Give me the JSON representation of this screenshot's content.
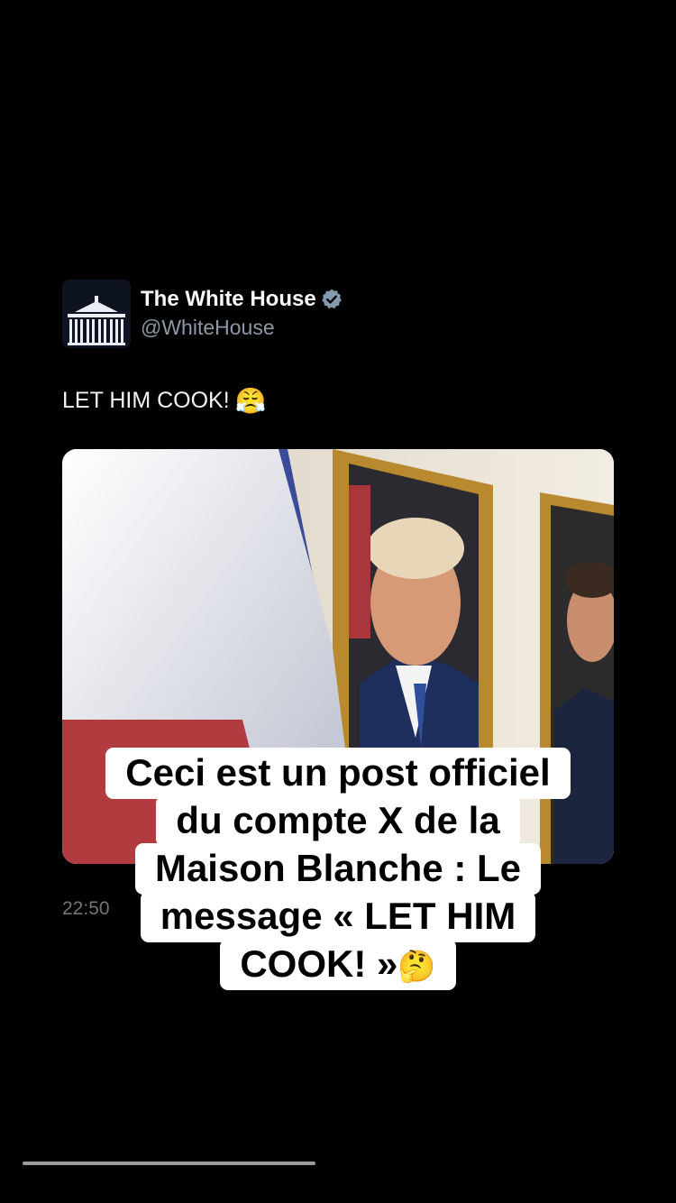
{
  "post": {
    "author_name": "The White House",
    "author_handle": "@WhiteHouse",
    "verified_icon": "verified-badge-icon",
    "text": "LET HIM COOK!",
    "text_emoji": "😤",
    "timestamp": "22:50"
  },
  "caption": {
    "lines": [
      "Ceci est un post officiel",
      "du compte X de la",
      "Maison Blanche : Le",
      "message « LET HIM",
      "COOK! »"
    ],
    "end_emoji": "🤔"
  },
  "colors": {
    "background": "#000000",
    "caption_bg": "#ffffff",
    "verified": "#829aab"
  }
}
